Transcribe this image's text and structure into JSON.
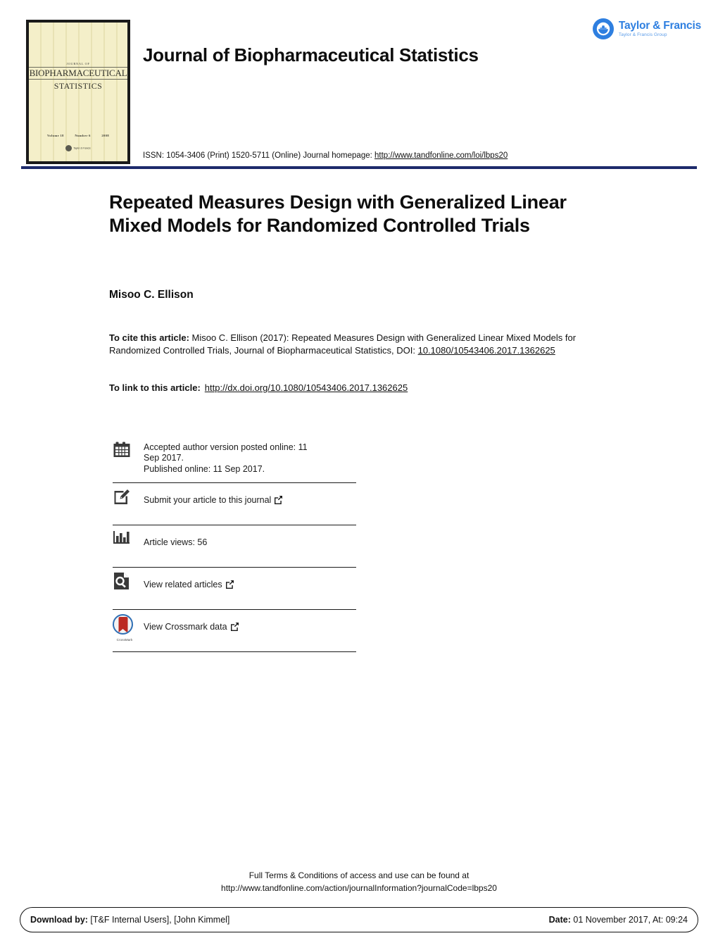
{
  "journal": {
    "title": "Journal of Biopharmaceutical Statistics",
    "issn_line": "ISSN: 1054-3406 (Print) 1520-5711 (Online) Journal homepage: ",
    "homepage_url": "http://www.tandfonline.com/loi/lbps20",
    "accent_navy": "#1d2a6b"
  },
  "cover": {
    "kicker": "JOURNAL OF",
    "line1": "BIOPHARMACEUTICAL",
    "line2": "STATISTICS",
    "volume": "Volume 18",
    "number": "Number 6",
    "year": "2008",
    "publisher": "Taylor & Francis"
  },
  "publisher_logo": {
    "name": "Taylor & Francis",
    "group": "Taylor & Francis Group",
    "color": "#2e7fe0"
  },
  "article": {
    "title": "Repeated Measures Design with Generalized Linear Mixed Models for Randomized Controlled Trials",
    "author": "Misoo C. Ellison",
    "cite_label": "To cite this article:",
    "cite_text": " Misoo C. Ellison (2017): Repeated Measures Design with Generalized Linear Mixed Models for Randomized Controlled Trials, Journal of Biopharmaceutical Statistics, DOI: ",
    "doi": "10.1080/10543406.2017.1362625",
    "link_label": "To link to this article:",
    "link_url": "http://dx.doi.org/10.1080/10543406.2017.1362625"
  },
  "metadata": {
    "rows": [
      {
        "icon": "calendar-icon",
        "line1": "Accepted author version posted online: 11",
        "line2": "Sep 2017.",
        "line3": "Published online: 11 Sep 2017."
      },
      {
        "icon": "pencil-square-icon",
        "label": "Submit your article to this journal",
        "external": true
      },
      {
        "icon": "bar-chart-icon",
        "label": "Article views: 56",
        "external": false
      },
      {
        "icon": "article-search-icon",
        "label": "View related articles",
        "external": true
      },
      {
        "icon": "crossmark-icon",
        "label": "View Crossmark data",
        "external": true,
        "icon_caption": "CrossMark"
      }
    ]
  },
  "footer": {
    "terms_line1": "Full Terms & Conditions of access and use can be found at",
    "terms_line2": "http://www.tandfonline.com/action/journalInformation?journalCode=lbps20",
    "download_label": "Download by:",
    "download_value": " [T&F Internal Users], [John Kimmel]",
    "date_label": "Date:",
    "date_value": " 01 November 2017, At: 09:24"
  }
}
